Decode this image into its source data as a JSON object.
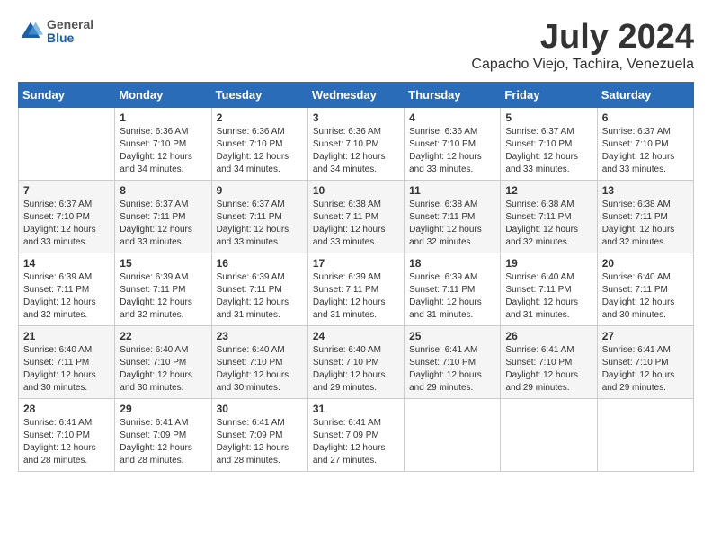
{
  "header": {
    "logo": {
      "general": "General",
      "blue": "Blue"
    },
    "title": "July 2024",
    "location": "Capacho Viejo, Tachira, Venezuela"
  },
  "calendar": {
    "weekdays": [
      "Sunday",
      "Monday",
      "Tuesday",
      "Wednesday",
      "Thursday",
      "Friday",
      "Saturday"
    ],
    "weeks": [
      [
        {
          "day": null,
          "info": null
        },
        {
          "day": "1",
          "sunrise": "6:36 AM",
          "sunset": "7:10 PM",
          "daylight": "12 hours and 34 minutes."
        },
        {
          "day": "2",
          "sunrise": "6:36 AM",
          "sunset": "7:10 PM",
          "daylight": "12 hours and 34 minutes."
        },
        {
          "day": "3",
          "sunrise": "6:36 AM",
          "sunset": "7:10 PM",
          "daylight": "12 hours and 34 minutes."
        },
        {
          "day": "4",
          "sunrise": "6:36 AM",
          "sunset": "7:10 PM",
          "daylight": "12 hours and 33 minutes."
        },
        {
          "day": "5",
          "sunrise": "6:37 AM",
          "sunset": "7:10 PM",
          "daylight": "12 hours and 33 minutes."
        },
        {
          "day": "6",
          "sunrise": "6:37 AM",
          "sunset": "7:10 PM",
          "daylight": "12 hours and 33 minutes."
        }
      ],
      [
        {
          "day": "7",
          "sunrise": "6:37 AM",
          "sunset": "7:10 PM",
          "daylight": "12 hours and 33 minutes."
        },
        {
          "day": "8",
          "sunrise": "6:37 AM",
          "sunset": "7:11 PM",
          "daylight": "12 hours and 33 minutes."
        },
        {
          "day": "9",
          "sunrise": "6:37 AM",
          "sunset": "7:11 PM",
          "daylight": "12 hours and 33 minutes."
        },
        {
          "day": "10",
          "sunrise": "6:38 AM",
          "sunset": "7:11 PM",
          "daylight": "12 hours and 33 minutes."
        },
        {
          "day": "11",
          "sunrise": "6:38 AM",
          "sunset": "7:11 PM",
          "daylight": "12 hours and 32 minutes."
        },
        {
          "day": "12",
          "sunrise": "6:38 AM",
          "sunset": "7:11 PM",
          "daylight": "12 hours and 32 minutes."
        },
        {
          "day": "13",
          "sunrise": "6:38 AM",
          "sunset": "7:11 PM",
          "daylight": "12 hours and 32 minutes."
        }
      ],
      [
        {
          "day": "14",
          "sunrise": "6:39 AM",
          "sunset": "7:11 PM",
          "daylight": "12 hours and 32 minutes."
        },
        {
          "day": "15",
          "sunrise": "6:39 AM",
          "sunset": "7:11 PM",
          "daylight": "12 hours and 32 minutes."
        },
        {
          "day": "16",
          "sunrise": "6:39 AM",
          "sunset": "7:11 PM",
          "daylight": "12 hours and 31 minutes."
        },
        {
          "day": "17",
          "sunrise": "6:39 AM",
          "sunset": "7:11 PM",
          "daylight": "12 hours and 31 minutes."
        },
        {
          "day": "18",
          "sunrise": "6:39 AM",
          "sunset": "7:11 PM",
          "daylight": "12 hours and 31 minutes."
        },
        {
          "day": "19",
          "sunrise": "6:40 AM",
          "sunset": "7:11 PM",
          "daylight": "12 hours and 31 minutes."
        },
        {
          "day": "20",
          "sunrise": "6:40 AM",
          "sunset": "7:11 PM",
          "daylight": "12 hours and 30 minutes."
        }
      ],
      [
        {
          "day": "21",
          "sunrise": "6:40 AM",
          "sunset": "7:11 PM",
          "daylight": "12 hours and 30 minutes."
        },
        {
          "day": "22",
          "sunrise": "6:40 AM",
          "sunset": "7:10 PM",
          "daylight": "12 hours and 30 minutes."
        },
        {
          "day": "23",
          "sunrise": "6:40 AM",
          "sunset": "7:10 PM",
          "daylight": "12 hours and 30 minutes."
        },
        {
          "day": "24",
          "sunrise": "6:40 AM",
          "sunset": "7:10 PM",
          "daylight": "12 hours and 29 minutes."
        },
        {
          "day": "25",
          "sunrise": "6:41 AM",
          "sunset": "7:10 PM",
          "daylight": "12 hours and 29 minutes."
        },
        {
          "day": "26",
          "sunrise": "6:41 AM",
          "sunset": "7:10 PM",
          "daylight": "12 hours and 29 minutes."
        },
        {
          "day": "27",
          "sunrise": "6:41 AM",
          "sunset": "7:10 PM",
          "daylight": "12 hours and 29 minutes."
        }
      ],
      [
        {
          "day": "28",
          "sunrise": "6:41 AM",
          "sunset": "7:10 PM",
          "daylight": "12 hours and 28 minutes."
        },
        {
          "day": "29",
          "sunrise": "6:41 AM",
          "sunset": "7:09 PM",
          "daylight": "12 hours and 28 minutes."
        },
        {
          "day": "30",
          "sunrise": "6:41 AM",
          "sunset": "7:09 PM",
          "daylight": "12 hours and 28 minutes."
        },
        {
          "day": "31",
          "sunrise": "6:41 AM",
          "sunset": "7:09 PM",
          "daylight": "12 hours and 27 minutes."
        },
        {
          "day": null,
          "info": null
        },
        {
          "day": null,
          "info": null
        },
        {
          "day": null,
          "info": null
        }
      ]
    ]
  },
  "labels": {
    "sunrise": "Sunrise:",
    "sunset": "Sunset:",
    "daylight_prefix": "Daylight: "
  }
}
